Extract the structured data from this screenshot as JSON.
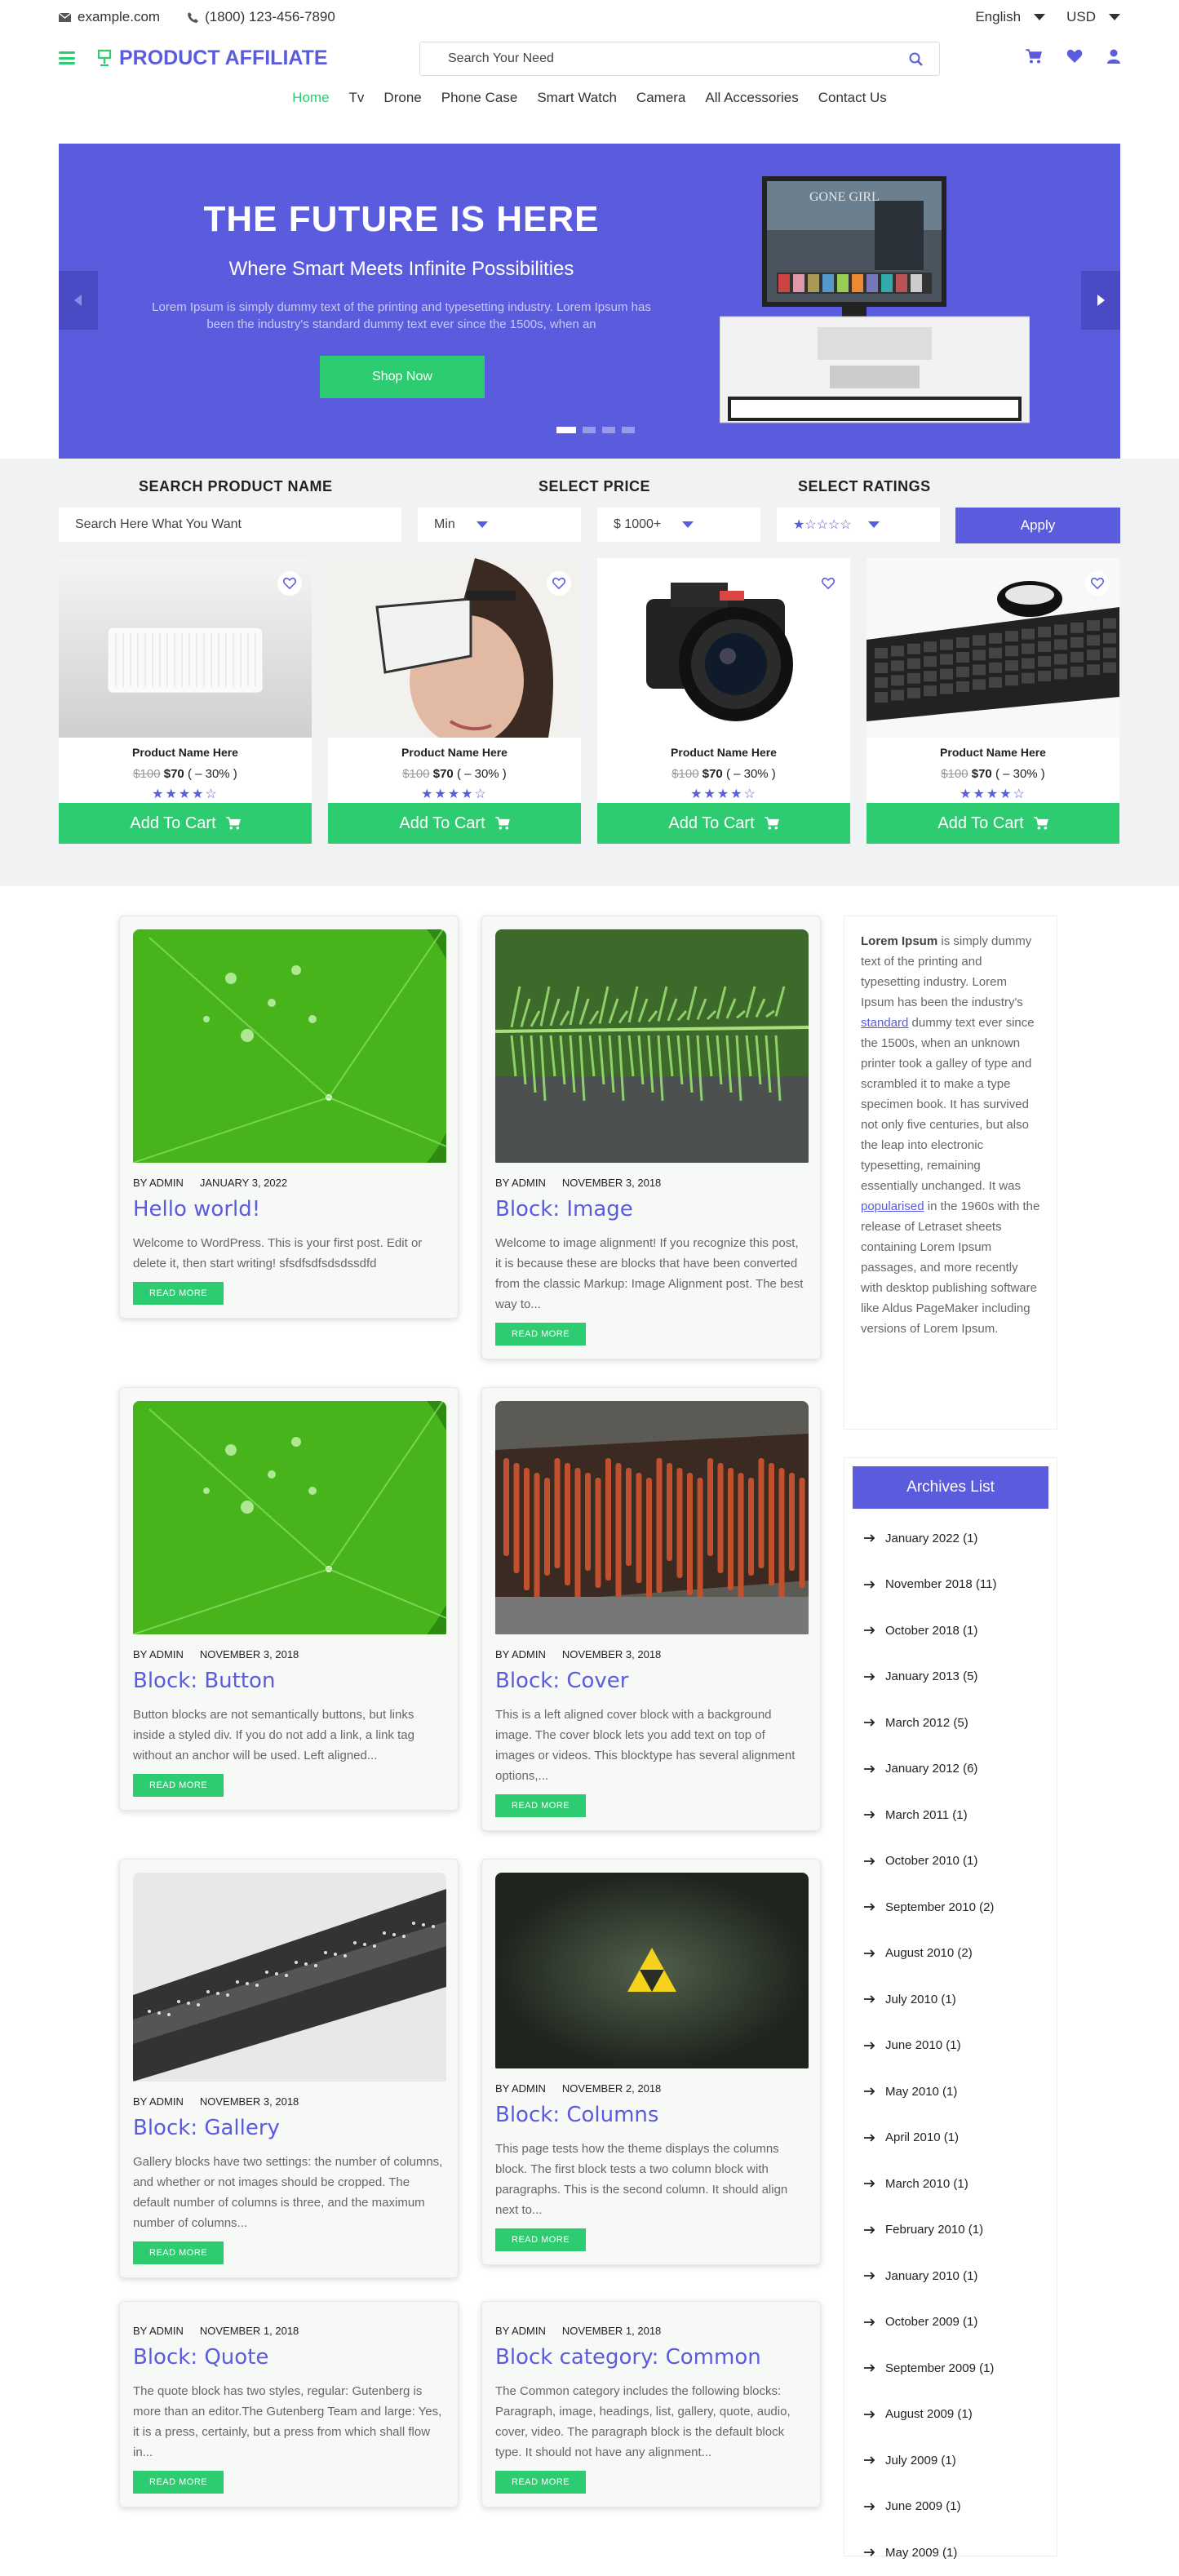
{
  "topbar": {
    "email": "example.com",
    "phone": "(1800) 123-456-7890",
    "language": "English",
    "currency": "USD"
  },
  "header": {
    "logo": "PRODUCT AFFILIATE",
    "search_placeholder": "Search Your Need"
  },
  "nav": [
    "Home",
    "Tv",
    "Drone",
    "Phone Case",
    "Smart Watch",
    "Camera",
    "All Accessories",
    "Contact Us"
  ],
  "hero": {
    "title": "THE FUTURE IS HERE",
    "subtitle": "Where Smart Meets Infinite Possibilities",
    "text": "Lorem Ipsum is simply dummy text of the printing and typesetting industry. Lorem Ipsum has been the industry's standard dummy text ever since the 1500s, when an",
    "button": "Shop Now",
    "tv_title": "GONE GIRL"
  },
  "filters": {
    "name_label": "SEARCH PRODUCT NAME",
    "name_placeholder": "Search Here What You Want",
    "price_label": "SELECT PRICE",
    "price_min": "Min",
    "price_max": "$ 1000+",
    "rating_label": "SELECT RATINGS",
    "rating_value": "★☆☆☆☆",
    "apply": "Apply"
  },
  "products": [
    {
      "name": "Product Name Here",
      "old": "$100",
      "price": "$70",
      "discount": "( – 30% )",
      "stars": "★★★★☆",
      "cart": "Add To Cart"
    },
    {
      "name": "Product Name Here",
      "old": "$100",
      "price": "$70",
      "discount": "( – 30% )",
      "stars": "★★★★☆",
      "cart": "Add To Cart"
    },
    {
      "name": "Product Name Here",
      "old": "$100",
      "price": "$70",
      "discount": "( – 30% )",
      "stars": "★★★★☆",
      "cart": "Add To Cart"
    },
    {
      "name": "Product Name Here",
      "old": "$100",
      "price": "$70",
      "discount": "( – 30% )",
      "stars": "★★★★☆",
      "cart": "Add To Cart"
    }
  ],
  "posts": [
    {
      "author": "BY ADMIN",
      "date": "JANUARY 3, 2022",
      "title": "Hello world!",
      "excerpt": "Welcome to WordPress. This is your first post. Edit or delete it, then start writing! sfsdfsdfsdsdssdfd",
      "button": "READ MORE"
    },
    {
      "author": "BY ADMIN",
      "date": "NOVEMBER 3, 2018",
      "title": "Block: Image",
      "excerpt": "Welcome to image alignment! If you recognize this post, it is because these are blocks that have been converted from the classic Markup: Image Alignment post. The best way to...",
      "button": "READ MORE"
    },
    {
      "author": "BY ADMIN",
      "date": "NOVEMBER 3, 2018",
      "title": "Block: Button",
      "excerpt": "Button blocks are not semantically buttons, but links inside a styled div.  If you do not add a link, a link tag without an anchor will be used. Left aligned...",
      "button": "READ MORE"
    },
    {
      "author": "BY ADMIN",
      "date": "NOVEMBER 3, 2018",
      "title": "Block: Cover",
      "excerpt": "This is a left aligned cover block with a background image. The cover block lets you add text on top of images or videos. This blocktype has several alignment options,...",
      "button": "READ MORE"
    },
    {
      "author": "BY ADMIN",
      "date": "NOVEMBER 3, 2018",
      "title": "Block: Gallery",
      "excerpt": "Gallery blocks have two settings: the number of columns, and whether or not images should be cropped. The default number of columns is three, and the maximum number of columns...",
      "button": "READ MORE"
    },
    {
      "author": "BY ADMIN",
      "date": "NOVEMBER 2, 2018",
      "title": "Block: Columns",
      "excerpt": "This page tests how the theme displays the columns block. The first block tests a two column block with paragraphs. This is the second column. It should align next to...",
      "button": "READ MORE"
    },
    {
      "author": "BY ADMIN",
      "date": "NOVEMBER 1, 2018",
      "title": "Block: Quote",
      "excerpt": "The quote block has two styles, regular: Gutenberg is more than an editor.The Gutenberg Team and large: Yes, it is a press, certainly, but a press from which shall flow in...",
      "button": "READ MORE"
    },
    {
      "author": "BY ADMIN",
      "date": "NOVEMBER 1, 2018",
      "title": "Block category: Common",
      "excerpt": "The Common category includes the following blocks: Paragraph, image, headings, list, gallery, quote, audio, cover, video. The paragraph block is the default block type.  It should not have any alignment...",
      "button": "READ MORE"
    }
  ],
  "sidebar": {
    "text_bold": "Lorem Ipsum",
    "text_a": " is simply dummy text of the printing and typesetting industry. Lorem Ipsum has been the industry's ",
    "link1": "standard",
    "text_b": " dummy text ever since the 1500s, when an unknown printer took a galley of type and scrambled it to make a type specimen book. It has survived not only five centuries, but also the leap into electronic typesetting, remaining essentially unchanged. It was ",
    "link2": "popularised",
    "text_c": " in the 1960s with the release of Letraset sheets containing Lorem Ipsum passages, and more recently with desktop publishing software like Aldus PageMaker including versions of Lorem Ipsum.",
    "archives_title": "Archives List",
    "archives": [
      "January 2022 (1)",
      "November 2018 (11)",
      "October 2018 (1)",
      "January 2013 (5)",
      "March 2012 (5)",
      "January 2012 (6)",
      "March 2011 (1)",
      "October 2010 (1)",
      "September 2010 (2)",
      "August 2010 (2)",
      "July 2010 (1)",
      "June 2010 (1)",
      "May 2010 (1)",
      "April 2010 (1)",
      "March 2010 (1)",
      "February 2010 (1)",
      "January 2010 (1)",
      "October 2009 (1)",
      "September 2009 (1)",
      "August 2009 (1)",
      "July 2009 (1)",
      "June 2009 (1)",
      "May 2009 (1)"
    ]
  }
}
